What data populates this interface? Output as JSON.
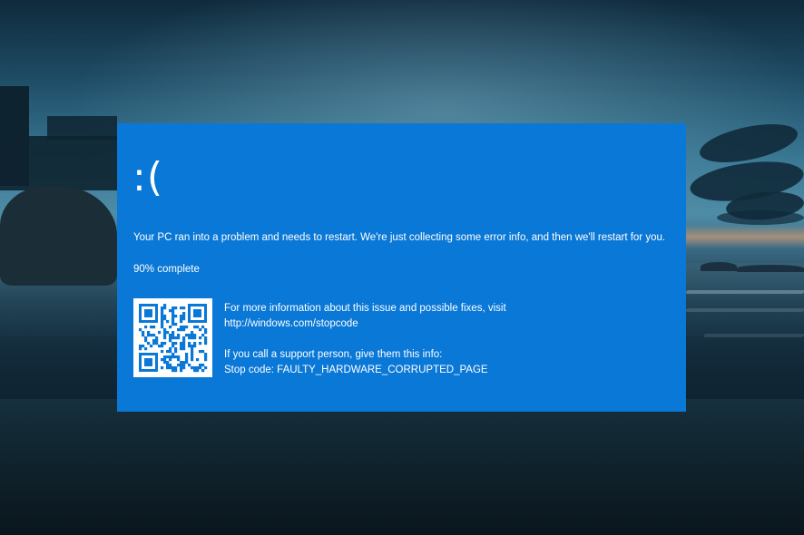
{
  "screen": {
    "sad_face": ":(",
    "message": "Your PC ran into a problem and needs to restart. We're just collecting some error info, and then we'll restart for you.",
    "progress_percent": 90,
    "progress_text": "90% complete",
    "more_info_text": "For more information about this issue and possible fixes, visit",
    "more_info_url": "http://windows.com/stopcode",
    "support_text": "If you call a support person, give them this info:",
    "stop_code_text": "Stop code: FAULTY_HARDWARE_CORRUPTED_PAGE"
  },
  "colors": {
    "bsod_blue": "#0a78d7",
    "text": "#ffffff"
  },
  "icons": {
    "qr_code": "qr-code-icon"
  }
}
